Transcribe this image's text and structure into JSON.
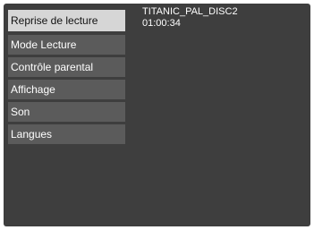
{
  "menu": {
    "items": [
      {
        "label": "Reprise de lecture",
        "selected": true
      },
      {
        "label": "Mode Lecture",
        "selected": false
      },
      {
        "label": "Contrôle parental",
        "selected": false
      },
      {
        "label": "Affichage",
        "selected": false
      },
      {
        "label": "Son",
        "selected": false
      },
      {
        "label": "Langues",
        "selected": false
      }
    ]
  },
  "disc": {
    "title": "TITANIC_PAL_DISC2",
    "time": "01:00:34"
  },
  "colors": {
    "background": "#3e3e3e",
    "menu_item": "#5b5b5b",
    "menu_item_selected": "#d6d6d6",
    "text": "#ffffff"
  }
}
